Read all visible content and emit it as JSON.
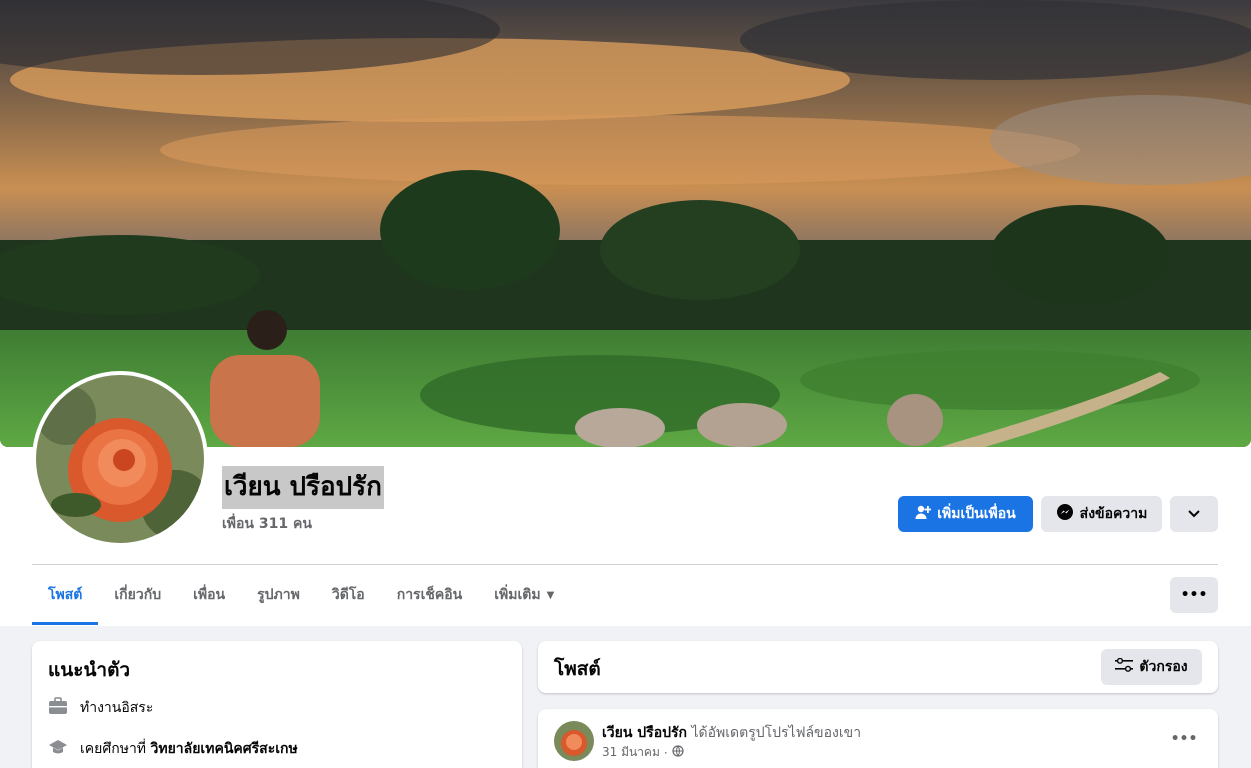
{
  "profile": {
    "name": "เวียน ปรือปรัก",
    "friends": "เพื่อน 311 คน"
  },
  "actions": {
    "add_friend": "เพิ่มเป็นเพื่อน",
    "message": "ส่งข้อความ"
  },
  "tabs": [
    {
      "label": "โพสต์"
    },
    {
      "label": "เกี่ยวกับ"
    },
    {
      "label": "เพื่อน"
    },
    {
      "label": "รูปภาพ"
    },
    {
      "label": "วิดีโอ"
    },
    {
      "label": "การเช็คอิน"
    },
    {
      "label": "เพิ่มเติม"
    }
  ],
  "intro": {
    "title": "แนะนำตัว",
    "work": "ทำงานอิสระ",
    "education_prefix": "เคยศึกษาที่",
    "education_school": "วิทยาลัยเทคนิคศรีสะเกษ"
  },
  "posts_section": {
    "title": "โพสต์",
    "filter": "ตัวกรอง"
  },
  "post": {
    "author": "เวียน ปรือปรัก",
    "action": "ได้อัพเดตรูปโปรไฟล์ของเขา",
    "date": "31 มีนาคม",
    "separator": "·"
  },
  "icons": {
    "add_friend": "add-person-icon",
    "message": "messenger-icon",
    "dropdown": "chevron-down-icon",
    "more": "more-dots-icon",
    "work": "briefcase-icon",
    "education": "graduation-cap-icon",
    "filter": "filter-icon",
    "privacy": "globe-icon"
  },
  "colors": {
    "accent": "#1b74e4",
    "secondary_button": "#e4e6eb",
    "muted_text": "#65676b",
    "background": "#f0f2f5"
  }
}
